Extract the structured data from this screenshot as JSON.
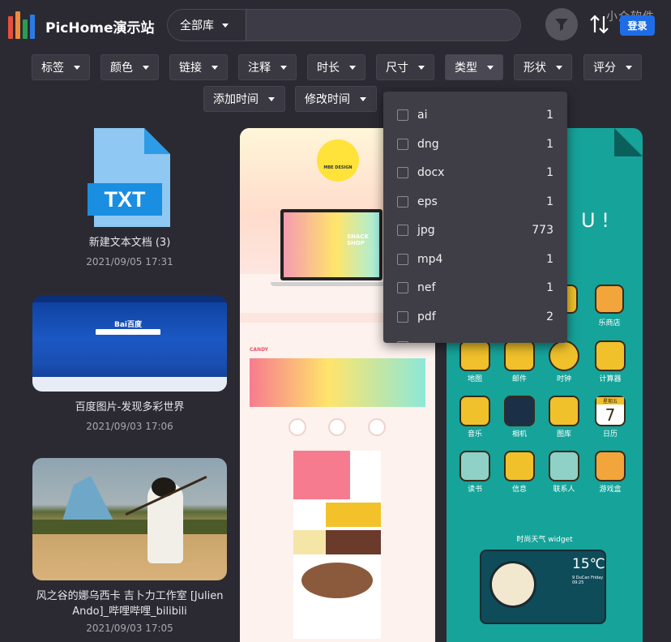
{
  "app": {
    "title": "PicHome演示站",
    "logo_colors": [
      "#e94f3a",
      "#2a9d4f",
      "#f5b82e",
      "#2c7be5"
    ]
  },
  "search": {
    "library_label": "全部库",
    "placeholder": ""
  },
  "header": {
    "watermark": "小众软件",
    "login_label": "登录",
    "filter_icon": "funnel-icon",
    "sort_icon": "sort-arrows-icon"
  },
  "filters": {
    "row1": [
      "标签",
      "颜色",
      "链接",
      "注释",
      "时长",
      "尺寸",
      "类型",
      "形状",
      "评分"
    ],
    "row2": [
      "添加时间",
      "修改时间"
    ]
  },
  "type_dropdown": {
    "items": [
      {
        "label": "ai",
        "count": "1"
      },
      {
        "label": "dng",
        "count": "1"
      },
      {
        "label": "docx",
        "count": "1"
      },
      {
        "label": "eps",
        "count": "1"
      },
      {
        "label": "jpg",
        "count": "773"
      },
      {
        "label": "mp4",
        "count": "1"
      },
      {
        "label": "nef",
        "count": "1"
      },
      {
        "label": "pdf",
        "count": "2"
      }
    ]
  },
  "cards": {
    "txt": {
      "icon_text": "TXT",
      "title": "新建文本文档 (3)",
      "date": "2021/09/05 17:31"
    },
    "baidu": {
      "logo_text": "Bai百度",
      "title": "百度图片-发现多彩世界",
      "date": "2021/09/03 17:06"
    },
    "violin": {
      "title_line1": "风之谷的娜乌西卡 吉卜力工作室 [Julien",
      "title_line2": "Ando]_哔哩哔哩_bilibili",
      "date": "2021/09/03 17:05"
    },
    "design": {
      "badge_text": "MBE DESIGN",
      "snack_text": "SNACK SHOP",
      "brand_text": "CANDY"
    },
    "theme": {
      "hello_text": "U !",
      "icons_row2": [
        "地图",
        "邮件",
        "时钟",
        "计算器"
      ],
      "icons_row3": [
        "音乐",
        "相机",
        "图库",
        "日历"
      ],
      "icons_row4": [
        "读书",
        "信息",
        "联系人",
        "游戏盒"
      ],
      "row1_labels": [
        "夹",
        "乐商店"
      ],
      "calendar_day": "7",
      "calendar_week": "星期五",
      "widget_label": "时尚天气 widget",
      "temp": "15℃",
      "weather_detail": "9 DuCan Friday 09:25"
    }
  }
}
